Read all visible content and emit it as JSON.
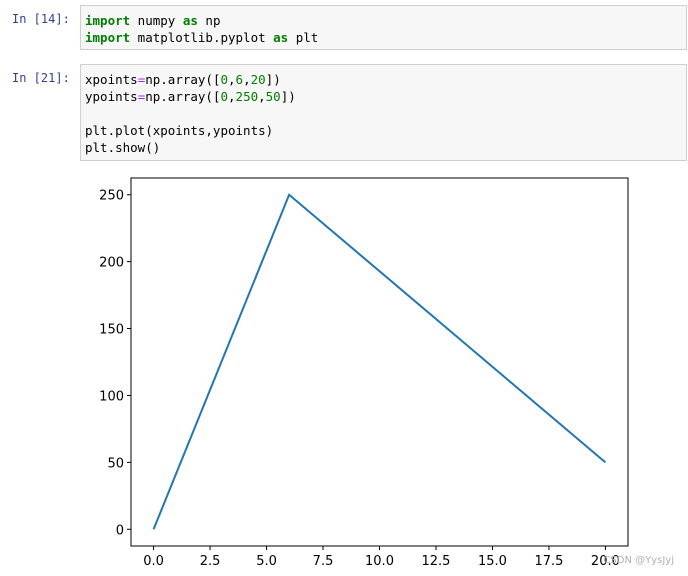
{
  "cells": [
    {
      "prompt": "In  [14]:",
      "lines": [
        [
          {
            "t": "import",
            "c": "kw"
          },
          {
            "t": " numpy "
          },
          {
            "t": "as",
            "c": "kw"
          },
          {
            "t": " np"
          }
        ],
        [
          {
            "t": "import",
            "c": "kw"
          },
          {
            "t": " matplotlib.pyplot "
          },
          {
            "t": "as",
            "c": "kw"
          },
          {
            "t": " plt"
          }
        ]
      ]
    },
    {
      "prompt": "In  [21]:",
      "lines": [
        [
          {
            "t": "xpoints"
          },
          {
            "t": "=",
            "c": "op"
          },
          {
            "t": "np.array(["
          },
          {
            "t": "0",
            "c": "num"
          },
          {
            "t": ","
          },
          {
            "t": "6",
            "c": "num"
          },
          {
            "t": ","
          },
          {
            "t": "20",
            "c": "num"
          },
          {
            "t": "])"
          }
        ],
        [
          {
            "t": "ypoints"
          },
          {
            "t": "=",
            "c": "op"
          },
          {
            "t": "np.array(["
          },
          {
            "t": "0",
            "c": "num"
          },
          {
            "t": ","
          },
          {
            "t": "250",
            "c": "num"
          },
          {
            "t": ","
          },
          {
            "t": "50",
            "c": "num"
          },
          {
            "t": "])"
          }
        ],
        [
          {
            "t": ""
          }
        ],
        [
          {
            "t": "plt.plot(xpoints,ypoints)"
          }
        ],
        [
          {
            "t": "plt.show()"
          }
        ]
      ]
    }
  ],
  "chart_data": {
    "type": "line",
    "x": [
      0,
      6,
      20
    ],
    "series": [
      {
        "values": [
          0,
          250,
          50
        ],
        "color": "#1f77b4"
      }
    ],
    "xlim": [
      -1,
      21
    ],
    "ylim": [
      -12.5,
      262.5
    ],
    "xticks": [
      "0.0",
      "2.5",
      "5.0",
      "7.5",
      "10.0",
      "12.5",
      "15.0",
      "17.5",
      "20.0"
    ],
    "xtick_values": [
      0,
      2.5,
      5,
      7.5,
      10,
      12.5,
      15,
      17.5,
      20
    ],
    "yticks": [
      "0",
      "50",
      "100",
      "150",
      "200",
      "250"
    ],
    "ytick_values": [
      0,
      50,
      100,
      150,
      200,
      250
    ],
    "grid": false
  },
  "watermark": "CSDN @YysJyj"
}
